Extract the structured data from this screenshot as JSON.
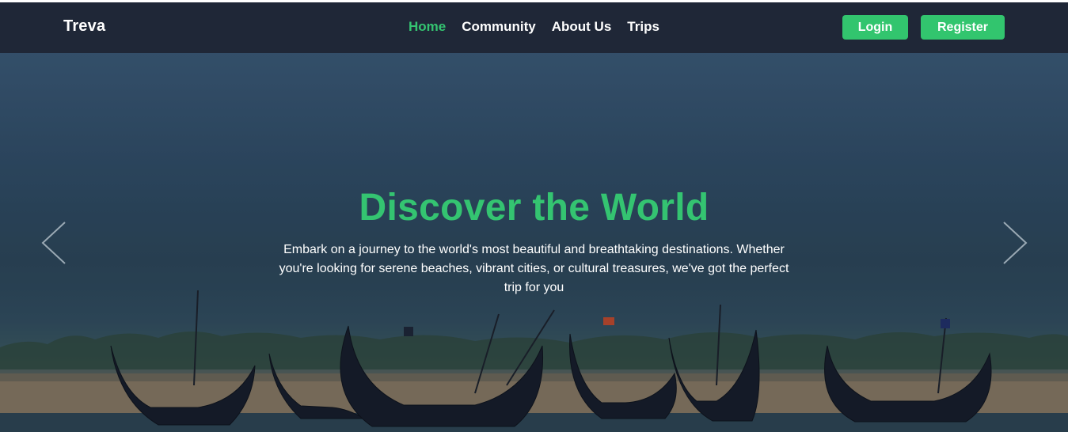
{
  "navbar": {
    "brand": "Treva",
    "links": [
      {
        "label": "Home",
        "active": true
      },
      {
        "label": "Community",
        "active": false
      },
      {
        "label": "About Us",
        "active": false
      },
      {
        "label": "Trips",
        "active": false
      }
    ],
    "login_label": "Login",
    "register_label": "Register"
  },
  "hero": {
    "title": "Discover the World",
    "description": "Embark on a journey to the world's most beautiful and breathtaking destinations. Whether you're looking for serene beaches, vibrant cities, or cultural treasures, we've got the perfect trip for you",
    "prev_icon": "chevron-left-icon",
    "next_icon": "chevron-right-icon"
  },
  "colors": {
    "navbar_bg": "#1f2737",
    "accent_green": "#34c471",
    "button_green": "#32c56e"
  }
}
